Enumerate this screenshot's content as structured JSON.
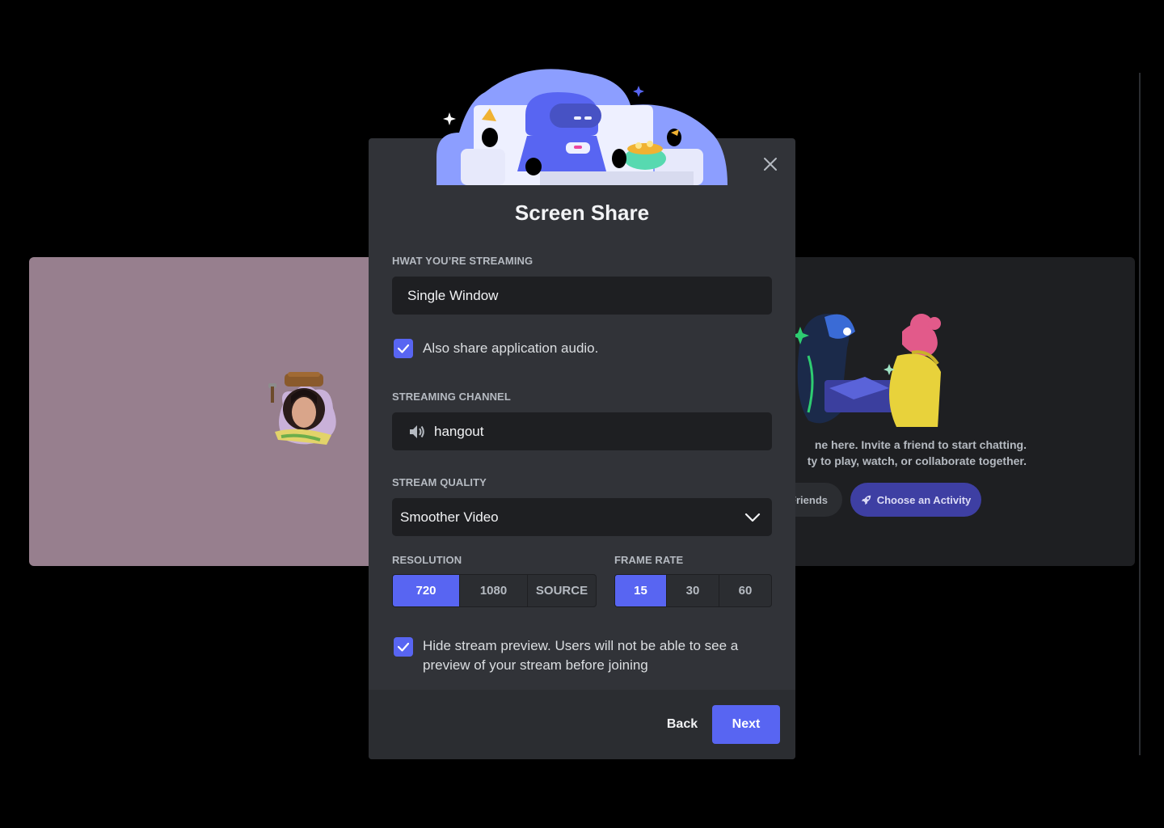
{
  "background": {
    "empty_state_line1": "ne here. Invite a friend to start chatting.",
    "empty_state_line2": "ty to play, watch, or collaborate together.",
    "friends_button": "Friends",
    "activity_button": "Choose an Activity",
    "icons": [
      "avatar",
      "rocket-icon"
    ]
  },
  "modal": {
    "title": "Screen Share",
    "streaming_label": "HWAT YOU’RE STREAMING",
    "streaming_value": "Single Window",
    "audio_checkbox_label": "Also share application audio.",
    "audio_checked": true,
    "channel_label": "STREAMING CHANNEL",
    "channel_name": "hangout",
    "quality_label": "STREAM QUALITY",
    "quality_value": "Smoother Video",
    "resolution_label": "RESOLUTION",
    "resolution_options": [
      "720",
      "1080",
      "SOURCE"
    ],
    "resolution_selected": "720",
    "framerate_label": "FRAME RATE",
    "framerate_options": [
      "15",
      "30",
      "60"
    ],
    "framerate_selected": "15",
    "preview_checkbox_line1": "Hide stream preview. Users will not be able to see a",
    "preview_checkbox_line2": "preview of your stream before joining",
    "preview_checked": true,
    "back_button": "Back",
    "next_button": "Next"
  },
  "colors": {
    "accent": "#5865f2",
    "modal_bg": "#313338",
    "field_bg": "#1e1f22",
    "tile_left_bg": "#977f8e"
  }
}
